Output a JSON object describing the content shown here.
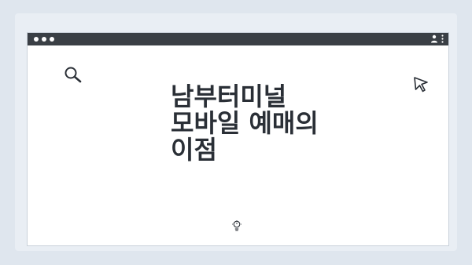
{
  "heading": {
    "line1": "남부터미널",
    "line2": "모바일 예매의",
    "line3": "이점"
  },
  "icons": {
    "search": "search-icon",
    "cursor": "cursor-arrow-icon",
    "user": "user-icon",
    "menu": "kebab-menu-icon",
    "bulb": "lightbulb-icon"
  },
  "colors": {
    "background": "#dfe6ee",
    "card": "#e9eef4",
    "titlebar": "#3a3f45",
    "window": "#ffffff",
    "text": "#2a2f36"
  }
}
